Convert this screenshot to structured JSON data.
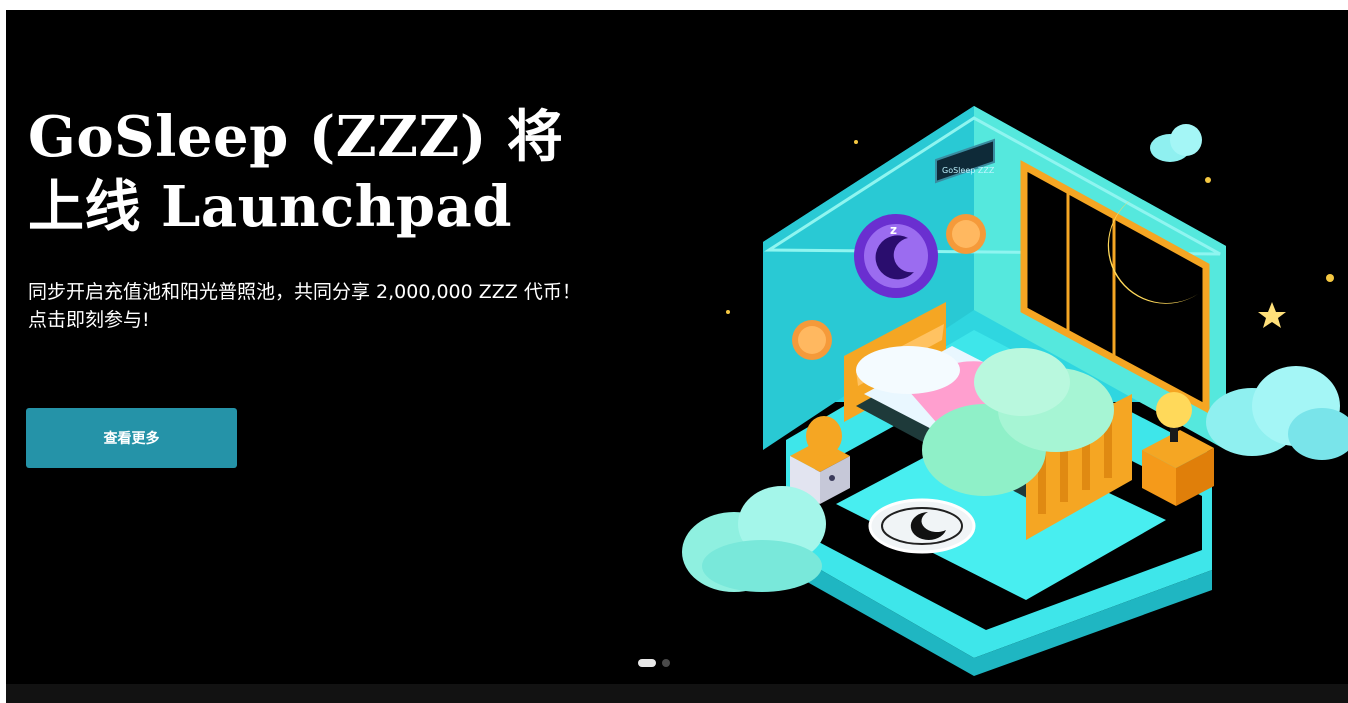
{
  "hero": {
    "title": "GoSleep (ZZZ) 将\n上线 Launchpad",
    "description": "同步开启充值池和阳光普照池，共同分享 2,000,000 ZZZ 代币！点击即刻参与!",
    "cta_label": "查看更多",
    "poster_brand": "GoSleep ZZZ"
  },
  "carousel": {
    "slide_count": 2,
    "active_index": 0
  },
  "colors": {
    "background": "#000000",
    "cta": "#2593a8",
    "room_teal": "#2ee0e6",
    "furniture_orange": "#f5a623",
    "moon_yellow": "#ffd95a",
    "clock_purple": "#7b3fe4"
  },
  "icons": [
    "moon-icon",
    "star-icon",
    "clock-icon",
    "coin-icon",
    "lamp-icon",
    "cloud-icon",
    "bed-icon"
  ]
}
